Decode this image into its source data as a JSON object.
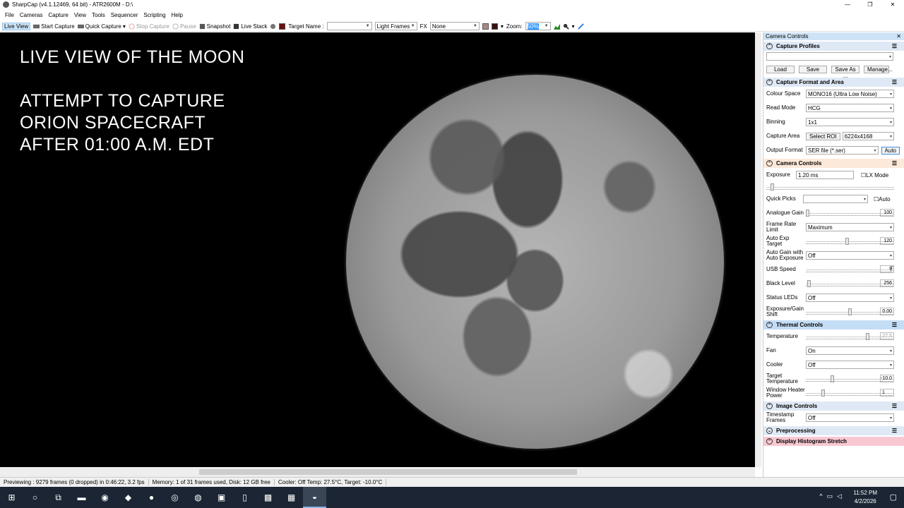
{
  "window": {
    "title": "SharpCap (v4.1.12469, 64 bit) - ATR2600M - D:\\",
    "min": "—",
    "max": "❐",
    "close": "✕"
  },
  "menu": [
    "File",
    "Cameras",
    "Capture",
    "View",
    "Tools",
    "Sequencer",
    "Scripting",
    "Help"
  ],
  "toolbar": {
    "live_view": "Live View",
    "start_capture": "Start Capture",
    "quick_capture": "Quick Capture",
    "stop_capture": "Stop Capture",
    "pause": "Pause",
    "snapshot": "Snapshot",
    "live_stack": "Live Stack",
    "target_name_label": "Target Name :",
    "target_name_value": "",
    "frame_type": "Light Frames",
    "fx_label": "FX",
    "fx_value": "None",
    "zoom_label": "Zoom:",
    "zoom_value": "50%"
  },
  "overlay": {
    "line1": "LIVE VIEW OF THE MOON",
    "line2": "ATTEMPT TO CAPTURE",
    "line3": "ORION SPACECRAFT",
    "line4": "AFTER 01:00 A.M. EDT"
  },
  "panel": {
    "title": "Camera Controls",
    "capture_profiles": {
      "header": "Capture Profiles",
      "load": "Load",
      "save": "Save",
      "save_as": "Save As ...",
      "manage": "Manage..."
    },
    "format": {
      "header": "Capture Format and Area",
      "colour_space_label": "Colour Space",
      "colour_space": "MONO16 (Ultra Low Noise)",
      "read_mode_label": "Read Mode",
      "read_mode": "HCG",
      "binning_label": "Binning",
      "binning": "1x1",
      "capture_area_label": "Capture Area",
      "select_roi": "Select ROI",
      "capture_area": "6224x4168",
      "output_format_label": "Output Format",
      "output_format": "SER file (*.ser)",
      "auto": "Auto"
    },
    "camera": {
      "header": "Camera Controls",
      "exposure_label": "Exposure",
      "exposure": "1.20 ms",
      "lx_mode": "LX Mode",
      "quick_picks_label": "Quick Picks",
      "auto": "Auto",
      "analogue_gain_label": "Analogue Gain",
      "analogue_gain": "100",
      "frame_rate_label": "Frame Rate Limit",
      "frame_rate": "Maximum",
      "auto_exp_label": "Auto Exp Target",
      "auto_exp": "120",
      "auto_gain_label": "Auto Gain with Auto Exposure",
      "auto_gain": "Off",
      "usb_speed_label": "USB Speed",
      "usb_speed": "9",
      "black_level_label": "Black Level",
      "black_level": "256",
      "status_leds_label": "Status LEDs",
      "status_leds": "Off",
      "exp_gain_shift_label": "Exposure/Gain Shift",
      "exp_gain_shift": "0.00"
    },
    "thermal": {
      "header": "Thermal Controls",
      "temperature_label": "Temperature",
      "temperature": "27.5",
      "fan_label": "Fan",
      "fan": "On",
      "cooler_label": "Cooler",
      "cooler": "Off",
      "target_temp_label": "Target Temperature",
      "target_temp": "-10.0",
      "heater_label": "Window Heater Power",
      "heater": "1"
    },
    "image": {
      "header": "Image Controls",
      "timestamp_label": "Timestamp Frames",
      "timestamp": "Off"
    },
    "preprocessing": {
      "header": "Preprocessing"
    },
    "histogram": {
      "header": "Display Histogram Stretch"
    }
  },
  "sliders": {
    "exposure": 0.05,
    "analogue_gain": 0.02,
    "auto_exp": 0.47,
    "usb_speed": 0.98,
    "black_level": 0.04,
    "exp_gain_shift": 0.5,
    "temperature": 0.7,
    "target_temp": 0.3,
    "heater": 0.2
  },
  "status": {
    "previewing": "Previewing : 9279 frames (0 dropped) in 0:46:22, 3.2 fps",
    "memory": "Memory: 1 of 31 frames used, Disk: 12 GB free",
    "cooler": "Cooler: Off Temp: 27.5°C, Target: -10.0°C"
  },
  "taskbar": {
    "time": "11:52 PM",
    "date": "4/2/2026"
  }
}
